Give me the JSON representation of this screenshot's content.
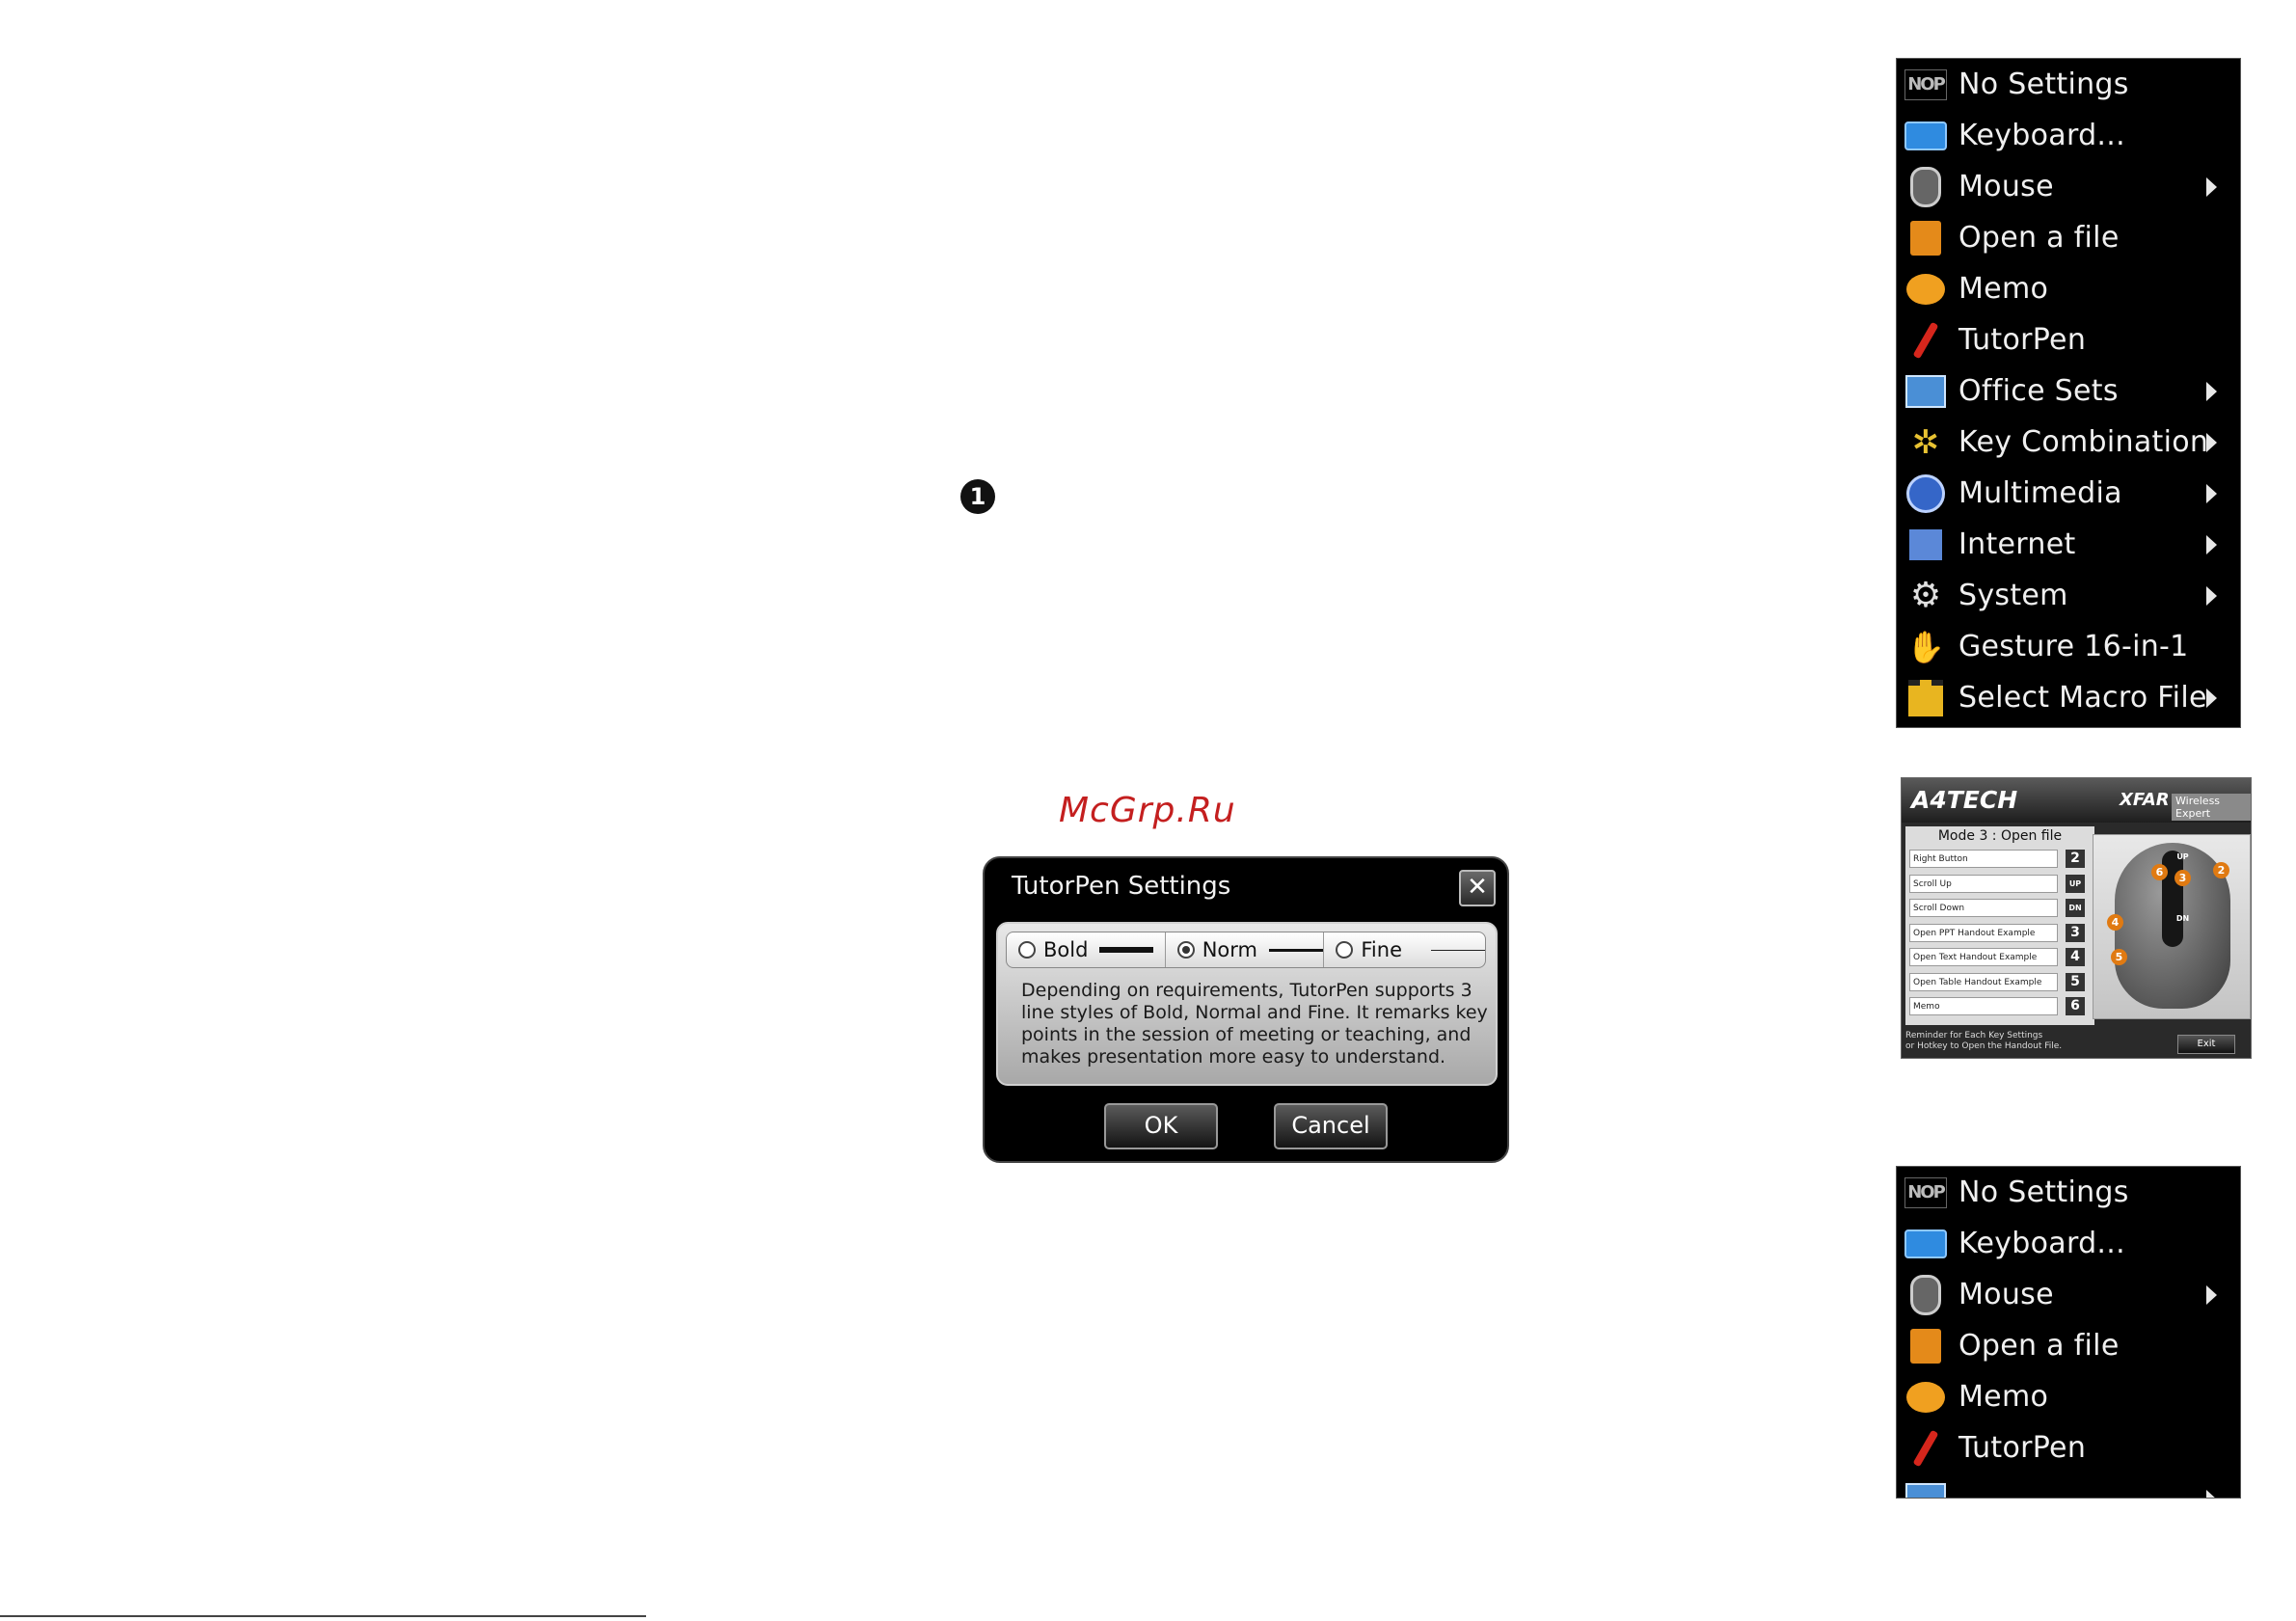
{
  "step_badge": "1",
  "watermark": "McGrp.Ru",
  "context_menu": {
    "items": [
      {
        "label": "No Settings",
        "icon": "nop-icon",
        "submenu": false
      },
      {
        "label": "Keyboard...",
        "icon": "keyboard-icon",
        "submenu": false
      },
      {
        "label": "Mouse",
        "icon": "mouse-icon",
        "submenu": true
      },
      {
        "label": "Open a file",
        "icon": "open-file-icon",
        "submenu": false
      },
      {
        "label": "Memo",
        "icon": "memo-icon",
        "submenu": false
      },
      {
        "label": "TutorPen",
        "icon": "pen-icon",
        "submenu": false
      },
      {
        "label": "Office Sets",
        "icon": "office-icon",
        "submenu": true
      },
      {
        "label": "Key Combination",
        "icon": "key-combination-icon",
        "submenu": true
      },
      {
        "label": "Multimedia",
        "icon": "multimedia-icon",
        "submenu": true
      },
      {
        "label": "Internet",
        "icon": "internet-icon",
        "submenu": true
      },
      {
        "label": "System",
        "icon": "gear-icon",
        "submenu": true
      },
      {
        "label": "Gesture 16-in-1",
        "icon": "hand-icon",
        "submenu": false
      },
      {
        "label": "Select Macro File",
        "icon": "macro-icon",
        "submenu": true
      }
    ]
  },
  "context_menu_2": {
    "items": [
      {
        "label": "No Settings"
      },
      {
        "label": "Keyboard..."
      },
      {
        "label": "Mouse"
      },
      {
        "label": "Open a file"
      },
      {
        "label": "Memo"
      },
      {
        "label": "TutorPen"
      }
    ]
  },
  "tutorpen_dialog": {
    "title": "TutorPen Settings",
    "close_glyph": "✕",
    "options": [
      {
        "label": "Bold",
        "selected": false
      },
      {
        "label": "Norm",
        "selected": true
      },
      {
        "label": "Fine",
        "selected": false
      }
    ],
    "description": "Depending on requirements, TutorPen supports 3 line styles of Bold, Normal and Fine. It remarks key points in the session of  meeting or teaching, and makes presentation more easy to understand.",
    "ok_label": "OK",
    "cancel_label": "Cancel"
  },
  "a4tech_panel": {
    "brand": "A4TECH",
    "product": "XFAR",
    "product_tag": "Wireless Expert",
    "mode_title": "Mode 3 : Open file",
    "rows": [
      {
        "field": "Right Button",
        "key": "2"
      },
      {
        "field": "Scroll Up",
        "key": "UP"
      },
      {
        "field": "Scroll Down",
        "key": "DN"
      },
      {
        "field": "Open PPT Handout Example",
        "key": "3"
      },
      {
        "field": "Open Text Handout Example",
        "key": "4"
      },
      {
        "field": "Open Table Handout Example",
        "key": "5"
      },
      {
        "field": "Memo",
        "key": "6"
      }
    ],
    "mouse_markers": [
      "6",
      "2",
      "3",
      "4",
      "5",
      "UP",
      "DN"
    ],
    "footer_line1": "Reminder for Each Key Settings",
    "footer_line2": "or Hotkey to Open the Handout File.",
    "exit_label": "Exit"
  }
}
